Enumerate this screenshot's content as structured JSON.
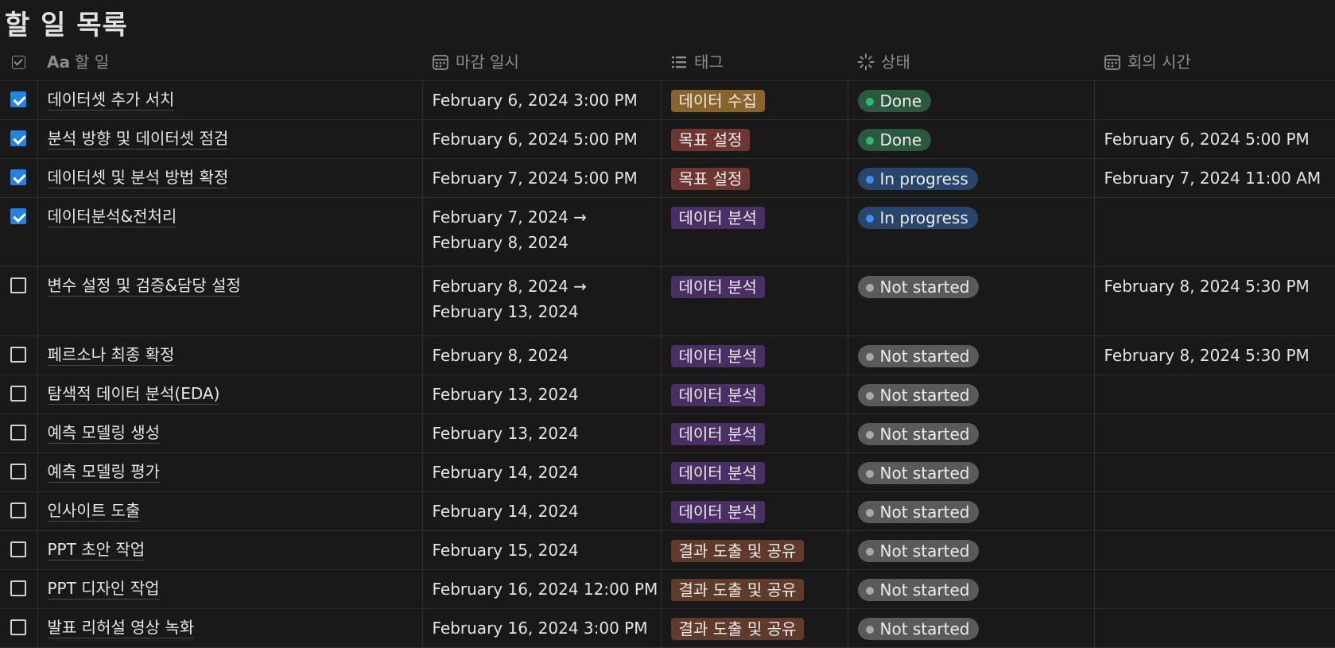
{
  "page": {
    "title": "할 일 목록"
  },
  "columns": [
    {
      "icon": "checkbox-icon",
      "label": ""
    },
    {
      "icon": "text-icon",
      "prefix": "Aa",
      "label": "할 일"
    },
    {
      "icon": "calendar-icon",
      "label": "마감 일시"
    },
    {
      "icon": "list-icon",
      "label": "태그"
    },
    {
      "icon": "status-icon",
      "label": "상태"
    },
    {
      "icon": "calendar-icon",
      "label": "회의 시간"
    }
  ],
  "tag_colors": {
    "데이터 수집": "#89632a",
    "목표 설정": "#6e3630",
    "데이터 분석": "#492f64",
    "결과 도출 및 공유": "#603b2c"
  },
  "status_colors": {
    "Done": {
      "bg": "#2b593f",
      "dot": "#2eb872"
    },
    "In progress": {
      "bg": "#28456c",
      "dot": "#3e8eea"
    },
    "Not started": {
      "bg": "#5a5a5a",
      "dot": "#a8a8a8"
    }
  },
  "rows": [
    {
      "checked": true,
      "task": "데이터셋 추가 서치",
      "due": "February 6, 2024 3:00 PM",
      "tag": "데이터 수집",
      "status": "Done",
      "meeting": ""
    },
    {
      "checked": true,
      "task": "분석 방향 및 데이터셋 점검",
      "due": "February 6, 2024 5:00 PM",
      "tag": "목표 설정",
      "status": "Done",
      "meeting": "February 6, 2024 5:00 PM"
    },
    {
      "checked": true,
      "task": "데이터셋 및 분석 방법 확정",
      "due": "February 7, 2024 5:00 PM",
      "tag": "목표 설정",
      "status": "In progress",
      "meeting": "February 7, 2024 11:00 AM"
    },
    {
      "checked": true,
      "task": "데이터분석&전처리",
      "due": "February 7, 2024 → February 8, 2024",
      "tag": "데이터 분석",
      "status": "In progress",
      "meeting": ""
    },
    {
      "checked": false,
      "task": "변수 설정 및 검증&담당 설정",
      "due": "February 8, 2024 → February 13, 2024",
      "tag": "데이터 분석",
      "status": "Not started",
      "meeting": "February 8, 2024 5:30 PM"
    },
    {
      "checked": false,
      "task": "페르소나 최종 확정",
      "due": "February 8, 2024",
      "tag": "데이터 분석",
      "status": "Not started",
      "meeting": "February 8, 2024 5:30 PM"
    },
    {
      "checked": false,
      "task": "탐색적 데이터 분석(EDA)",
      "due": "February 13, 2024",
      "tag": "데이터 분석",
      "status": "Not started",
      "meeting": ""
    },
    {
      "checked": false,
      "task": "예측 모델링 생성",
      "due": "February 13, 2024",
      "tag": "데이터 분석",
      "status": "Not started",
      "meeting": ""
    },
    {
      "checked": false,
      "task": "예측 모델링 평가",
      "due": "February 14, 2024",
      "tag": "데이터 분석",
      "status": "Not started",
      "meeting": ""
    },
    {
      "checked": false,
      "task": "인사이트 도출",
      "due": "February 14, 2024",
      "tag": "데이터 분석",
      "status": "Not started",
      "meeting": ""
    },
    {
      "checked": false,
      "task": "PPT 초안 작업",
      "due": "February 15, 2024",
      "tag": "결과 도출 및 공유",
      "status": "Not started",
      "meeting": ""
    },
    {
      "checked": false,
      "task": "PPT 디자인 작업",
      "due": "February 16, 2024 12:00 PM",
      "tag": "결과 도출 및 공유",
      "status": "Not started",
      "meeting": ""
    },
    {
      "checked": false,
      "task": "발표 리허설 영상 녹화",
      "due": "February 16, 2024 3:00 PM",
      "tag": "결과 도출 및 공유",
      "status": "Not started",
      "meeting": ""
    }
  ]
}
